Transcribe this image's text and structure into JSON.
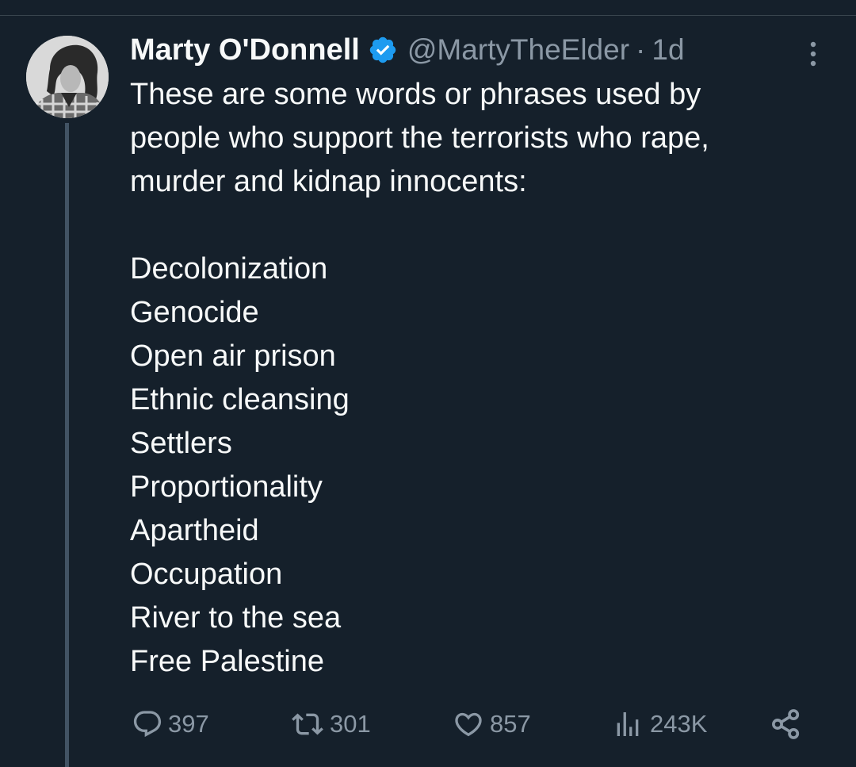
{
  "author": {
    "name": "Marty O'Donnell",
    "handle": "@MartyTheElder",
    "separator": "·",
    "time": "1d"
  },
  "tweet": {
    "intro_lines": [
      "These are some words or phrases used by",
      "people who support the terrorists who rape,",
      "murder and kidnap innocents:"
    ],
    "list": [
      "Decolonization",
      "Genocide",
      "Open air prison",
      "Ethnic cleansing",
      "Settlers",
      "Proportionality",
      "Apartheid",
      "Occupation",
      "River to the sea",
      "Free Palestine"
    ]
  },
  "actions": {
    "replies": "397",
    "reposts": "301",
    "likes": "857",
    "views": "243K"
  },
  "icons": {
    "badge": "verified-badge-icon",
    "reply": "reply-icon",
    "repost": "repost-icon",
    "like": "heart-icon",
    "views": "views-icon",
    "share": "share-icon",
    "more": "more-icon"
  },
  "colors": {
    "background": "#15202b",
    "text": "#f7f9f9",
    "secondary": "#8b98a5",
    "verified": "#1d9bf0"
  }
}
